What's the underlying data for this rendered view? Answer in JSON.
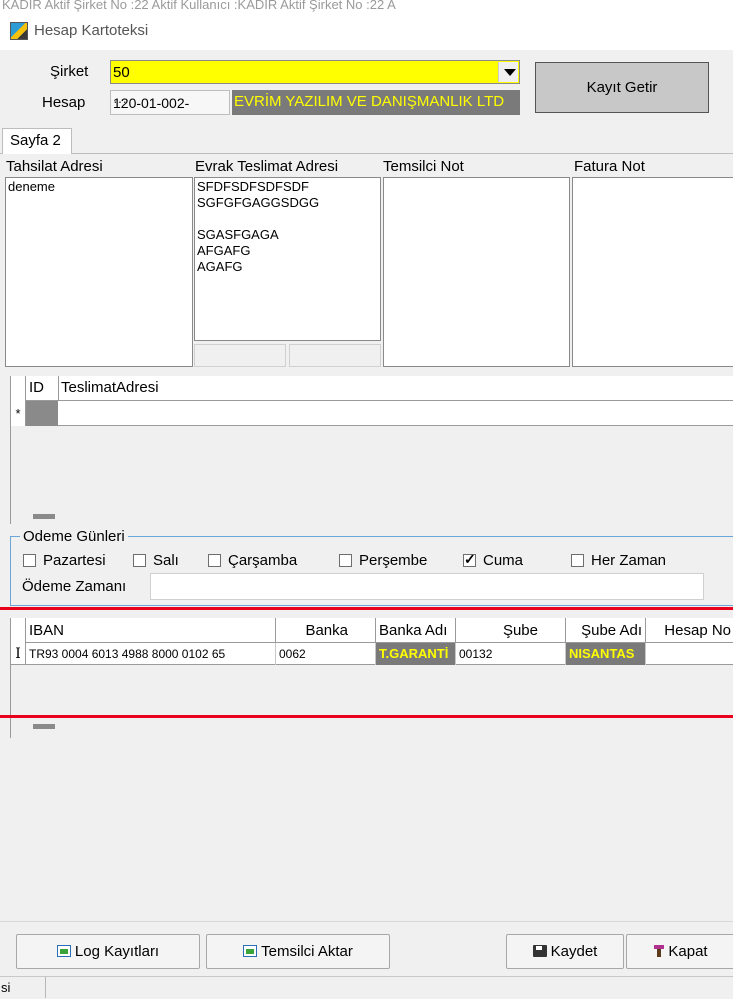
{
  "top_strip": "KADİR Aktif Şirket No :22 Aktif Kullanıcı :KADİR Aktif Şirket No :22 A",
  "window": {
    "title": "Hesap Kartoteksi",
    "icon": "app-icon"
  },
  "header": {
    "sirket_label": "Şirket",
    "sirket_value": "50",
    "hesap_label": "Hesap",
    "hesap_code": "120-01-002-",
    "hesap_lookup": "···",
    "hesap_name": "EVRİM YAZILIM VE DANIŞMANLIK LTD",
    "kayit_getir": "Kayıt Getir"
  },
  "tabs": [
    {
      "label": "Sayfa 2"
    }
  ],
  "notes": {
    "tahsilat_label": "Tahsilat Adresi",
    "tahsilat_value": "deneme",
    "evrak_label": "Evrak Teslimat Adresi",
    "evrak_value": "SFDFSDFSDFSDF\nSGFGFGAGGSDGG\n\nSGASFGAGA\nAFGAFG\nAGAFG",
    "temsilci_label": "Temsilci Not",
    "temsilci_value": "",
    "fatura_label": "Fatura Not",
    "fatura_value": ""
  },
  "teslimat_grid": {
    "columns": [
      "ID",
      "TeslimatAdresi"
    ],
    "new_row_marker": "*"
  },
  "odeme": {
    "group_label": "Odeme Günleri",
    "days": [
      {
        "label": "Pazartesi",
        "checked": false
      },
      {
        "label": "Salı",
        "checked": false
      },
      {
        "label": "Çarşamba",
        "checked": false
      },
      {
        "label": "Perşembe",
        "checked": false
      },
      {
        "label": "Cuma",
        "checked": true
      },
      {
        "label": "Her Zaman",
        "checked": false
      }
    ],
    "zaman_label": "Ödeme Zamanı",
    "zaman_value": ""
  },
  "iban_grid": {
    "columns": [
      "IBAN",
      "Banka",
      "Banka Adı",
      "Şube",
      "Şube Adı",
      "Hesap No"
    ],
    "rows": [
      {
        "iban": "TR93 0004 6013 4988 8000 0102 65",
        "banka": "0062",
        "banka_adi": "T.GARANTİ",
        "sube": "00132",
        "sube_adi": "NISANTAS",
        "hesap_no": ""
      }
    ],
    "row_cursor": "I"
  },
  "footer": {
    "log": "Log Kayıtları",
    "temsilci_aktar": "Temsilci Aktar",
    "kaydet": "Kaydet",
    "kapat": "Kapat"
  },
  "statusbar": {
    "cell1": "si"
  },
  "colors": {
    "highlight_yellow": "#ffff00",
    "readonly_gray": "#7a7a7a",
    "annotation_red": "#e8001c"
  }
}
